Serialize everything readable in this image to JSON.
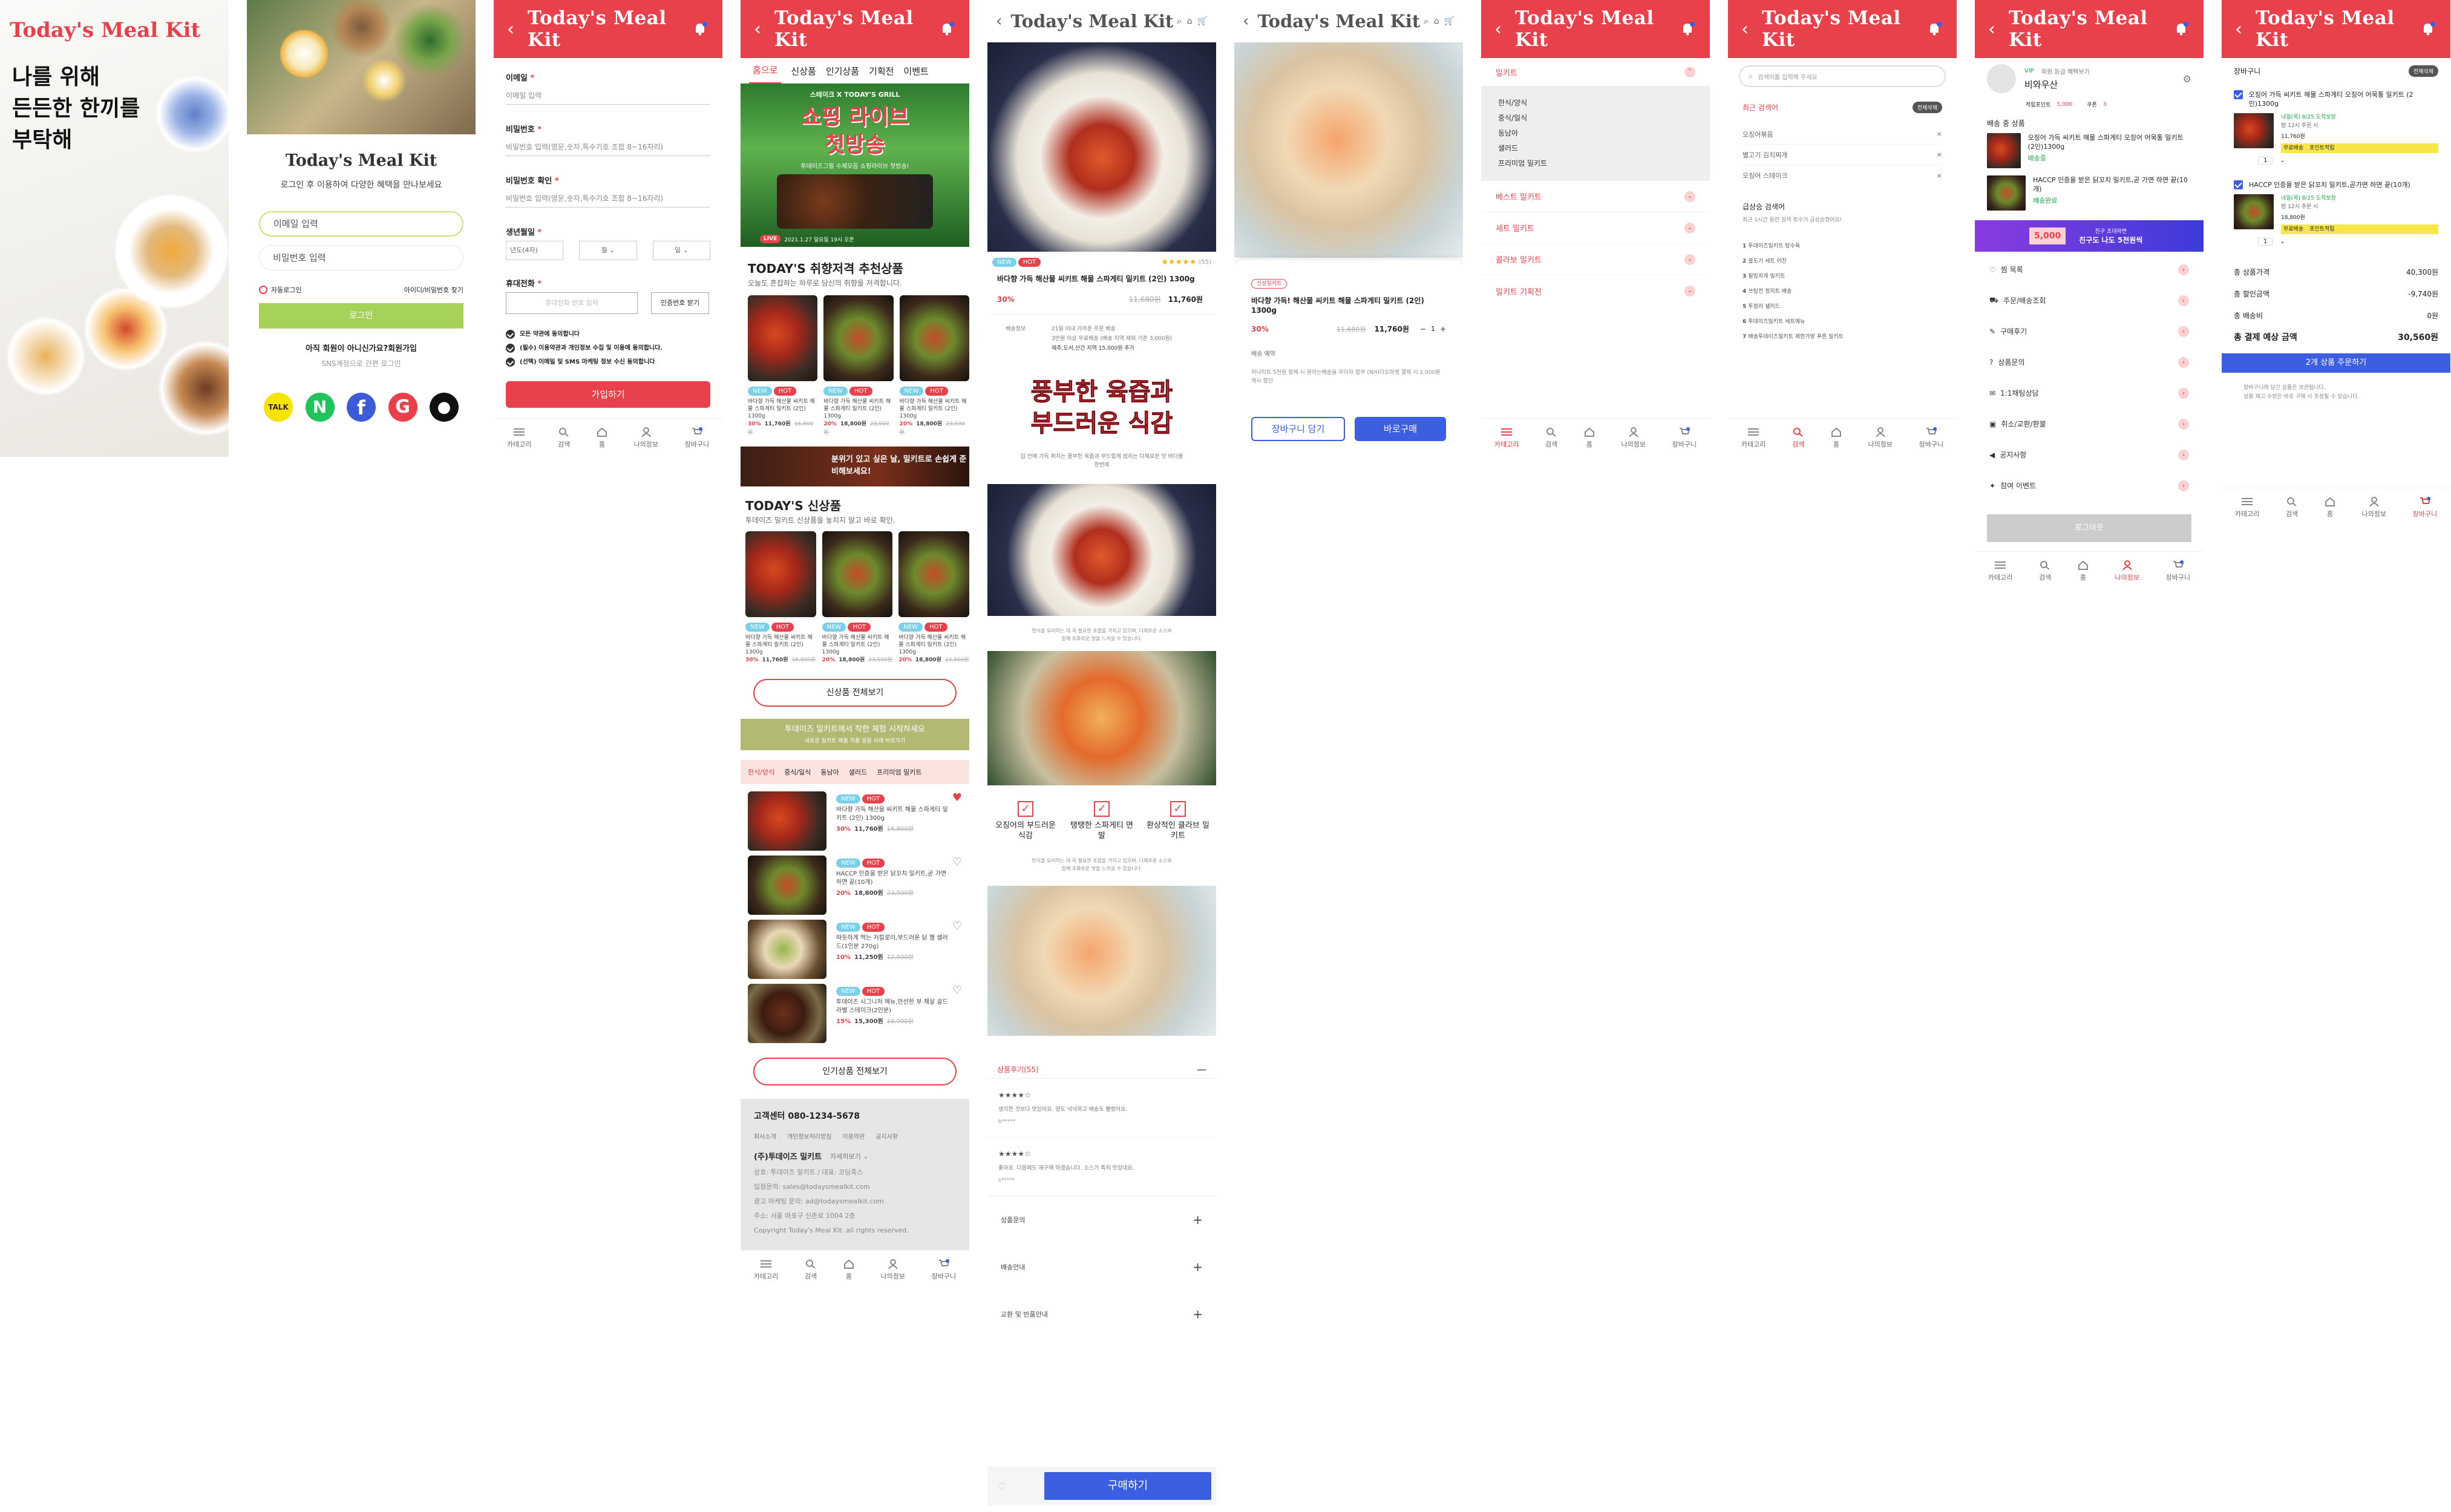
{
  "brand": {
    "name": "Today's Meal Kit",
    "accent": "#e8414b"
  },
  "tabbar": {
    "items": [
      "카테고리",
      "검색",
      "홈",
      "나의정보",
      "장바구니"
    ],
    "cart_count": "0"
  },
  "s1": {
    "logo": "Today's Meal Kit",
    "headline": [
      "나를 위해",
      "든든한 한끼를",
      "부탁해"
    ]
  },
  "s2": {
    "title": "Today's Meal Kit",
    "subtitle": "로그인 후 이용하여 다양한 혜택을 만나보세요",
    "email_ph": "이메일 입력",
    "pw_ph": "비밀번호 입력",
    "autologin": "자동로그인",
    "find": "아이디/비밀번호 찾기",
    "login": "로그인",
    "join_q": "아직 회원이 아니신가요?회원가입",
    "sns": "SNS계정으로 간편 로그인"
  },
  "s3": {
    "fields": [
      {
        "label": "이메일",
        "ph": "이메일 입력"
      },
      {
        "label": "비밀번호",
        "ph": "비밀번호 입력(영문,숫자,특수기호 조합 8~16자리)"
      },
      {
        "label": "비밀번호 확인",
        "ph": "비밀번호 입력(영문,숫자,특수기호 조합 8~16자리)"
      }
    ],
    "birth_label": "생년월일",
    "birth": [
      "년도(4자)",
      "월",
      "일"
    ],
    "phone_label": "휴대전화",
    "phone_ph": "휴대전화 번호 입력",
    "verify": "인증번호 받기",
    "agrees": [
      "모든 약관에 동의합니다",
      "(필수) 이용약관과 개인정보 수집 및 이용에 동의합니다.",
      "(선택) 이메일 및 SMS 마케팅 정보 수신 동의합니다"
    ],
    "submit": "가입하기"
  },
  "s4": {
    "tabs": [
      "홈으로",
      "신상품",
      "인기상품",
      "기획전",
      "이벤트"
    ],
    "banner": {
      "top": "스테이크 X TODAY'S GRILL",
      "title1": "쇼핑 라이브",
      "title2": "첫방송",
      "sub": "투데이즈그릴 수제모듬 쇼핑라이브 첫방송!",
      "live": "LIVE",
      "date": "2021.1.27 일요일 19시 오픈"
    },
    "rec_title": "TODAY'S 취향저격 추천상품",
    "rec_sub": "오늘도 흔잡하는 하루로 당신의 취향을 저격합니다.",
    "prod_name": "바다향 가득 해산물 씨키트 해물 스파게티 밀키트 (2인) 1300g",
    "price": {
      "dc": "30%",
      "now": "11,760원",
      "old": "16,800원"
    },
    "price2": {
      "dc": "20%",
      "now": "18,800원",
      "old": "23,500원"
    },
    "mid_banner": "분위기 있고 싶은 날, 밀키트로 손쉽게 준비해보세요!",
    "new_title": "TODAY'S 신상품",
    "new_sub": "투데이즈 밀키트 신상품을 놓치지 말고 바로 확인.",
    "new_all": "신상품 전체보기",
    "gift_banner": "투데이즈 밀키트에서 착한 체험 시작하세요",
    "gift_sub": "새로운 밀키트 제품 작품 응원 사례 바로가기",
    "cats": [
      "한식/양식",
      "중식/일식",
      "동남아",
      "샐러드",
      "프리미엄 밀키트"
    ],
    "list": [
      {
        "name": "바다향 가득 해산물 씨키트 해물 스파게티 밀키트 (2인) 1300g",
        "dc": "30%",
        "now": "11,760원",
        "old": "16,800원"
      },
      {
        "name": "HACCP 인증을 받은 닭꼬치 밀키트,곧 가면 하면 끝(10개)",
        "dc": "20%",
        "now": "18,800원",
        "old": "23,500원"
      },
      {
        "name": "따듯하게 먹는 저칼로리,부드러운 닭 햄 샐러드(1인분 270g)",
        "dc": "10%",
        "now": "11,250원",
        "old": "12,500원"
      },
      {
        "name": "투데이즈 시그니처 메뉴,안선한 부 채살 골드라벨 스테이크(2인분)",
        "dc": "15%",
        "now": "15,300원",
        "old": "18,000원"
      }
    ],
    "pop_all": "인기상품 전체보기",
    "footer": {
      "cs": "고객센터 080-1234-5678",
      "links": [
        "회사소개",
        "개인정보처리방침",
        "이용약관",
        "공지사항"
      ],
      "company": "(주)투데이즈 밀키트",
      "more": "자세히보기",
      "lines": [
        "상호: 투데이즈 밀키트 / 대표: 코딩죽스",
        "입점문의: sales@todaysmealkit.com",
        "광고 마케팅 문의: ad@todaysmealkit.com",
        "주소: 서울 마포구 신촌로 1004 2층",
        "Copyright Today's Meal Kit. all rights reserved."
      ]
    }
  },
  "s5": {
    "badge_new": "NEW",
    "badge_hot": "HOT",
    "rating": "(55)",
    "name": "바다향 가득 해산물 씨키트 해물 스파게티 밀키트 (2인) 1300g",
    "dc": "30%",
    "old": "11,680원",
    "now": "11,760원",
    "ship_label": "배송정보",
    "ship_lines": [
      "21일 이내 가까운 주문 배송",
      "3만원 이상 무료배송 (배송 지역 제외 기준 3,000원)",
      "제주,도서,산간 지역 15,000원 추가"
    ],
    "bigcopy1": "풍부한 육즙과",
    "bigcopy2": "부드러운 식감",
    "copy_small": "입 안에 가득 퍼지는 풍부한 육즙과 부드럽게 씹히는 다채로운 맛 바다를 한번에",
    "desc": "한식을 요리하는 데 꼭 필요한 조합을 가지고 있으며, 다채로운 소스와 함께 조화로운 맛을 느끼실 수 있습니다.",
    "features": [
      "오징어의 부드러운 식감",
      "탱탱한 스파게티 면발",
      "환상적인 클라브 밀키트"
    ],
    "review_title": "상품후기(55)",
    "reviews": [
      {
        "txt": "생각한 것보다 맛있어요. 양도 넉넉하고 배송도 빨랐어요.",
        "user": "b*****"
      },
      {
        "txt": "좋아요. 다음에도 재구매 하겠습니다. 소스가 특히 맛있네요.",
        "user": "s*****"
      }
    ],
    "acc": [
      "상품문의",
      "배송안내",
      "교환 및 반품안내"
    ],
    "buy": "구매하기"
  },
  "s6": {
    "tag": "신상밀키트",
    "name": "바다향 가득! 해산물 씨키트 해물 스파게티 밀키트 (2인) 1300g",
    "dc": "30%",
    "old": "11,680원",
    "now": "11,760원",
    "qty": "1",
    "ship": "배송 예약",
    "ship_text": "하나미트 5천원 함께 시 원하는배송을 무이자 할부 (NH)다오마켓 결제 시 2,000원 캐시 할인",
    "cart": "장바구니 담기",
    "buy": "바로구매"
  },
  "s7": {
    "groups": [
      {
        "name": "밀키트",
        "subs": [
          "한식/양식",
          "중식/일식",
          "동남아",
          "샐러드",
          "프리미엄 밀키트"
        ]
      },
      {
        "name": "베스트 밀키트",
        "subs": []
      },
      {
        "name": "세트 밀키트",
        "subs": []
      },
      {
        "name": "콜라보 밀키트",
        "subs": []
      },
      {
        "name": "밀키트 기획전",
        "subs": []
      }
    ]
  },
  "s8": {
    "search_ph": "검색어를 입력해 주세요",
    "recent": "최근 검색어",
    "delall": "전체삭제",
    "recents": [
      "오징어볶음",
      "별고기 김치찌개",
      "오징어 스테이크"
    ],
    "popular": "급상승 검색어",
    "popular_sub": "최근 1시간 동안 검색 횟수가 급상승했어요!",
    "rank": [
      "투데이즈밀키트 탕수육",
      "블도기 세트 어찬",
      "필링치게 밀키트",
      "쓰팅전 정지트 배송",
      "투정라 샐러드",
      "투데이즈밀키트 세트메뉴",
      "배송투데이즈밀키트 제한가방 푸른 밀키트"
    ]
  },
  "s9": {
    "grade": "VIP",
    "grade_text": "회원 등급 혜택보기",
    "name": "비와우산",
    "points_label": "적립포인트",
    "points": "5,000",
    "coupon_label": "쿠폰",
    "coupon": "3",
    "ship_title": "배송 중 상품",
    "items": [
      {
        "name": "오징어 가득 씨키트 해물 스파게티 오징어 어묵통 밀키트 (2인)1300g",
        "status": "배송중"
      },
      {
        "name": "HACCP 인증을 받은 닭꼬치 밀키트,곧 가면 하면 끝(10개)",
        "status": "배송완료"
      }
    ],
    "promo_amt": "5,000",
    "promo_title": "친구 초대하면",
    "promo_sub": "친구도 나도 5천원씩",
    "menu": [
      "찜 목록",
      "주문/배송조회",
      "구매후기",
      "상품문의",
      "1:1채팅상담",
      "취소/교환/환불",
      "공지사항",
      "참여 이벤트"
    ],
    "logout": "로그아웃"
  },
  "s10": {
    "title": "장바구니",
    "delall": "전체삭제",
    "items": [
      {
        "name": "오징어 가득 씨키트 해물 스파게티 오징어 어묵통 밀키트 (2인)1300g",
        "date": "내일(목) 8/25 도착보장",
        "time": "밤 12시 주문 시",
        "price": "11,760원",
        "qty": "1",
        "tags": [
          "무료배송",
          "포인트적립"
        ]
      },
      {
        "name": "HACCP 인증을 받은 닭꼬치 밀키트,곧가면 하면 끝(10개)",
        "date": "내일(목) 8/25 도착보장",
        "time": "밤 12시 주문 시",
        "price": "18,800원",
        "qty": "1",
        "tags": [
          "무료배송",
          "포인트적립"
        ]
      }
    ],
    "summary": [
      [
        "총 상품가격",
        "40,300원"
      ],
      [
        "총 할인금액",
        "-9,740원"
      ],
      [
        "총 배송비",
        "0원"
      ]
    ],
    "total_label": "총 결제 예상 금액",
    "total": "30,560원",
    "order": "2개 상품 주문하기",
    "notes": [
      "장바구니에 담긴 상품은 보관됩니다.",
      "상품 재고 수량은 바로 구매 시 조정될 수 있습니다."
    ]
  }
}
